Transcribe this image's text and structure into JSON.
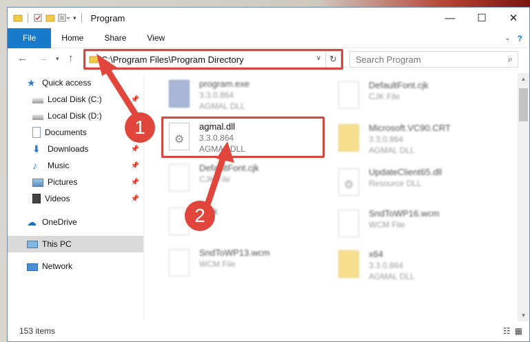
{
  "window": {
    "title": "Program"
  },
  "ribbon": {
    "tabs": [
      "File",
      "Home",
      "Share",
      "View"
    ]
  },
  "address": {
    "path": "C:\\Program Files\\Program Directory"
  },
  "search": {
    "placeholder": "Search Program"
  },
  "sidebar": {
    "items": [
      {
        "label": "Quick access",
        "icon": "star-icon"
      },
      {
        "label": "Local Disk (C:)",
        "icon": "drive-icon"
      },
      {
        "label": "Local Disk (D:)",
        "icon": "drive-icon"
      },
      {
        "label": "Documents",
        "icon": "documents-icon"
      },
      {
        "label": "Downloads",
        "icon": "download-icon"
      },
      {
        "label": "Music",
        "icon": "music-icon"
      },
      {
        "label": "Pictures",
        "icon": "pictures-icon"
      },
      {
        "label": "Videos",
        "icon": "videos-icon"
      },
      {
        "label": "OneDrive",
        "icon": "cloud-icon"
      },
      {
        "label": "This PC",
        "icon": "computer-icon"
      },
      {
        "label": "Network",
        "icon": "network-icon"
      }
    ]
  },
  "files": [
    {
      "name": "program.exe",
      "line1": "3.3.0.864",
      "line2": "AGMAL DLL",
      "icon": "exe-icon"
    },
    {
      "name": "DefaultFont.cjk",
      "line1": "CJK File",
      "line2": "",
      "icon": "file-icon"
    },
    {
      "name": "agmal.dll",
      "line1": "3.3.0.864",
      "line2": "AGMAL DLL",
      "icon": "dll-gear-icon"
    },
    {
      "name": "Microsoft.VC90.CRT",
      "line1": "3.3.0.864",
      "line2": "AGMAL DLL",
      "icon": "folder-icon"
    },
    {
      "name": "DefaultFont.cjk",
      "line1": "CJK File",
      "line2": "",
      "icon": "file-icon"
    },
    {
      "name": "UpdateClient65.dll",
      "line1": "Resource DLL",
      "line2": "",
      "icon": "dll-gear-icon"
    },
    {
      "name": "Task",
      "line1": "File",
      "line2": "",
      "icon": "file-icon"
    },
    {
      "name": "SndToWP16.wcm",
      "line1": "WCM File",
      "line2": "",
      "icon": "file-icon"
    },
    {
      "name": "SndToWP13.wcm",
      "line1": "WCM File",
      "line2": "",
      "icon": "file-icon"
    },
    {
      "name": "x64",
      "line1": "3.3.0.864",
      "line2": "AGMAL DLL",
      "icon": "folder-icon"
    }
  ],
  "status": {
    "items_count": "153 items"
  },
  "annotations": {
    "step1": "1",
    "step2": "2"
  },
  "colors": {
    "accent": "#1979ca",
    "highlight": "#d9463e"
  }
}
